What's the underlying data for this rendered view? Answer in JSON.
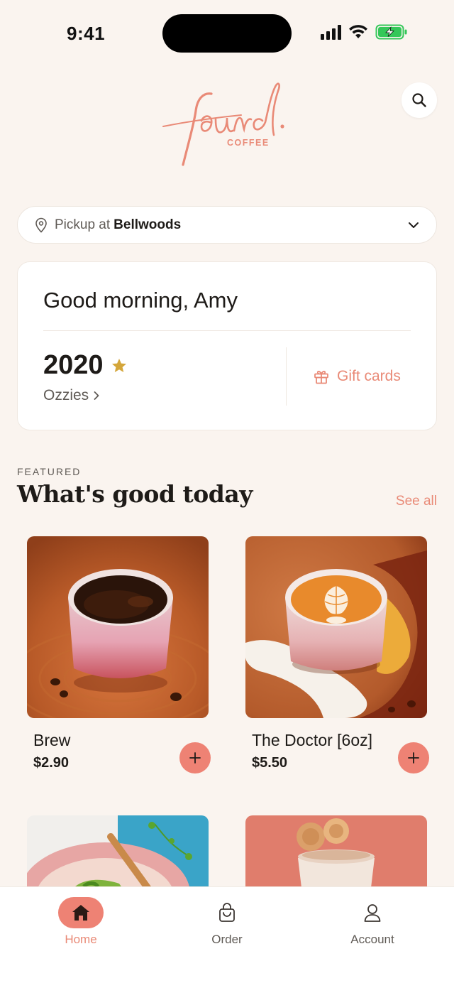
{
  "status_bar": {
    "time": "9:41"
  },
  "header": {
    "logo_word": "found.",
    "logo_sub": "COFFEE",
    "search_icon": "search-icon"
  },
  "pickup": {
    "prefix": "Pickup at",
    "store": "Bellwoods",
    "icon": "location-pin-icon"
  },
  "rewards_card": {
    "greeting": "Good morning, Amy",
    "points": "2020",
    "tier": "Ozzies",
    "gift_cards_label": "Gift cards"
  },
  "featured": {
    "eyebrow": "FEATURED",
    "title": "What's good today",
    "see_all": "See all",
    "products": [
      {
        "name": "Brew",
        "price": "$2.90"
      },
      {
        "name": "The Doctor [6oz]",
        "price": "$5.50"
      }
    ]
  },
  "tabs": [
    {
      "label": "Home",
      "icon": "home-icon",
      "active": true
    },
    {
      "label": "Order",
      "icon": "shopping-bag-icon",
      "active": false
    },
    {
      "label": "Account",
      "icon": "person-icon",
      "active": false
    }
  ],
  "colors": {
    "accent": "#ee8274",
    "accent_text": "#e98a77",
    "background": "#faf4ef",
    "star": "#d4a63a"
  }
}
